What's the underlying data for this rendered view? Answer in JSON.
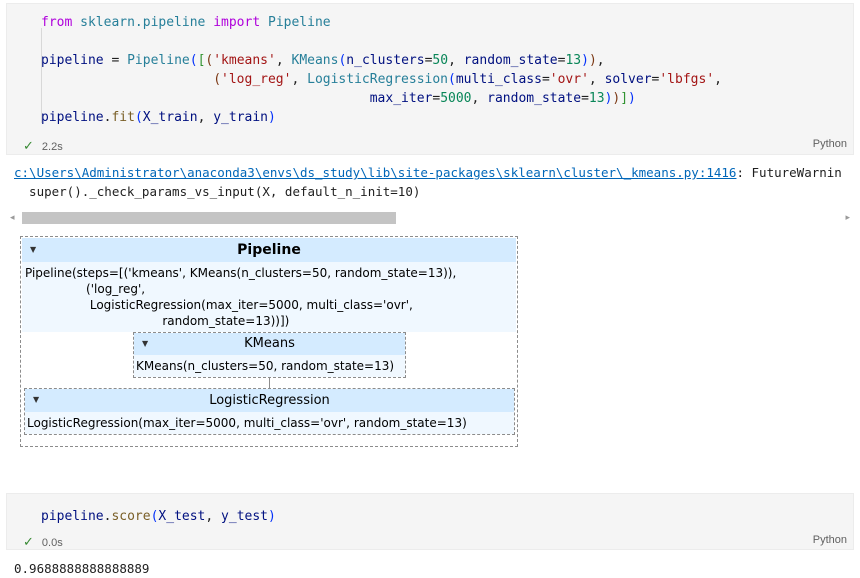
{
  "cell1": {
    "lines": [
      [
        {
          "t": "from",
          "c": "kw"
        },
        {
          "t": " sklearn.pipeline ",
          "c": "mod"
        },
        {
          "t": "import",
          "c": "kw"
        },
        {
          "t": " Pipeline",
          "c": "mod"
        }
      ],
      [],
      [
        {
          "t": "pipeline",
          "c": "var"
        },
        {
          "t": " = ",
          "c": ""
        },
        {
          "t": "Pipeline",
          "c": "mod"
        },
        {
          "t": "(",
          "c": "br1"
        },
        {
          "t": "[",
          "c": "br2"
        },
        {
          "t": "(",
          "c": "br3"
        },
        {
          "t": "'kmeans'",
          "c": "str"
        },
        {
          "t": ", ",
          "c": ""
        },
        {
          "t": "KMeans",
          "c": "mod"
        },
        {
          "t": "(",
          "c": "br1"
        },
        {
          "t": "n_clusters",
          "c": "var"
        },
        {
          "t": "=",
          "c": ""
        },
        {
          "t": "50",
          "c": "num"
        },
        {
          "t": ", ",
          "c": ""
        },
        {
          "t": "random_state",
          "c": "var"
        },
        {
          "t": "=",
          "c": ""
        },
        {
          "t": "13",
          "c": "num"
        },
        {
          "t": ")",
          "c": "br1"
        },
        {
          "t": ")",
          "c": "br3"
        },
        {
          "t": ",",
          "c": ""
        }
      ],
      [
        {
          "t": "                      ",
          "c": ""
        },
        {
          "t": "(",
          "c": "br3"
        },
        {
          "t": "'log_reg'",
          "c": "str"
        },
        {
          "t": ", ",
          "c": ""
        },
        {
          "t": "LogisticRegression",
          "c": "mod"
        },
        {
          "t": "(",
          "c": "br1"
        },
        {
          "t": "multi_class",
          "c": "var"
        },
        {
          "t": "=",
          "c": ""
        },
        {
          "t": "'ovr'",
          "c": "str"
        },
        {
          "t": ", ",
          "c": ""
        },
        {
          "t": "solver",
          "c": "var"
        },
        {
          "t": "=",
          "c": ""
        },
        {
          "t": "'lbfgs'",
          "c": "str"
        },
        {
          "t": ",",
          "c": ""
        }
      ],
      [
        {
          "t": "                                          ",
          "c": ""
        },
        {
          "t": "max_iter",
          "c": "var"
        },
        {
          "t": "=",
          "c": ""
        },
        {
          "t": "5000",
          "c": "num"
        },
        {
          "t": ", ",
          "c": ""
        },
        {
          "t": "random_state",
          "c": "var"
        },
        {
          "t": "=",
          "c": ""
        },
        {
          "t": "13",
          "c": "num"
        },
        {
          "t": ")",
          "c": "br1"
        },
        {
          "t": ")",
          "c": "br3"
        },
        {
          "t": "]",
          "c": "br2"
        },
        {
          "t": ")",
          "c": "br1"
        }
      ],
      [
        {
          "t": "pipeline",
          "c": "var"
        },
        {
          "t": ".",
          "c": ""
        },
        {
          "t": "fit",
          "c": "fn"
        },
        {
          "t": "(",
          "c": "br1"
        },
        {
          "t": "X_train",
          "c": "var"
        },
        {
          "t": ", ",
          "c": ""
        },
        {
          "t": "y_train",
          "c": "var"
        },
        {
          "t": ")",
          "c": "br1"
        }
      ]
    ],
    "status_time": "2.2s",
    "language": "Python"
  },
  "output1": {
    "warning_path": "c:\\Users\\Administrator\\anaconda3\\envs\\ds_study\\lib\\site-packages\\sklearn\\cluster\\_kmeans.py:1416",
    "warning_rest": ": FutureWarnin",
    "warning_line2": "  super()._check_params_vs_input(X, default_n_init=10)"
  },
  "diagram": {
    "pipeline_title": "Pipeline",
    "pipeline_repr": "Pipeline(steps=[('kmeans', KMeans(n_clusters=50, random_state=13)),\n                ('log_reg',\n                 LogisticRegression(max_iter=5000, multi_class='ovr',\n                                    random_state=13))])",
    "kmeans_title": "KMeans",
    "kmeans_repr": "KMeans(n_clusters=50, random_state=13)",
    "logreg_title": "LogisticRegression",
    "logreg_repr": "LogisticRegression(max_iter=5000, multi_class='ovr', random_state=13)"
  },
  "cell2": {
    "lines": [
      [
        {
          "t": "pipeline",
          "c": "var"
        },
        {
          "t": ".",
          "c": ""
        },
        {
          "t": "score",
          "c": "fn"
        },
        {
          "t": "(",
          "c": "br1"
        },
        {
          "t": "X_test",
          "c": "var"
        },
        {
          "t": ", ",
          "c": ""
        },
        {
          "t": "y_test",
          "c": "var"
        },
        {
          "t": ")",
          "c": "br1"
        }
      ]
    ],
    "status_time": "0.0s",
    "language": "Python"
  },
  "output2": {
    "result": "0.9688888888888889"
  },
  "colors": {
    "keyword": "#af00db",
    "module": "#267f99",
    "string": "#a31515",
    "number": "#098658",
    "link": "#0066b8",
    "diagram_header": "#d4ebff"
  },
  "icons": {
    "status": "check-icon",
    "collapse": "triangle-down-icon",
    "scroll_left": "chevron-left-icon",
    "scroll_right": "chevron-right-icon"
  }
}
